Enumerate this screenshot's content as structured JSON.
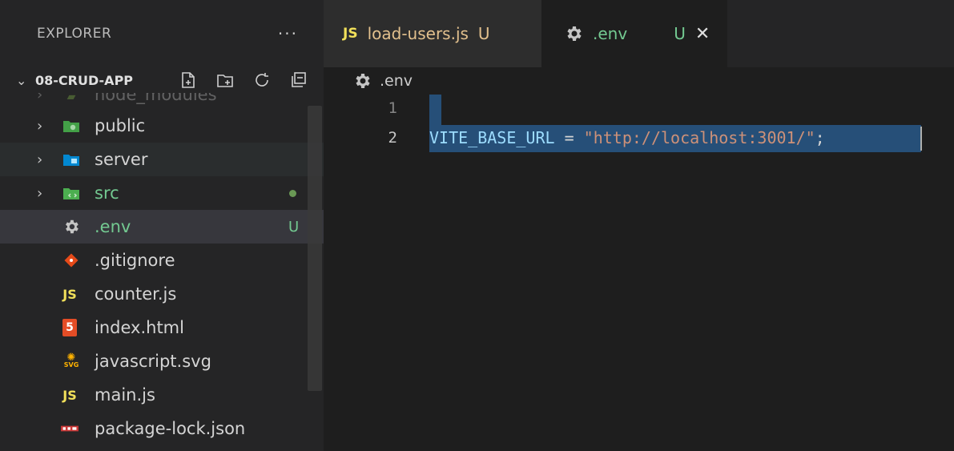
{
  "explorer": {
    "title": "EXPLORER",
    "more": "···",
    "folder_name": "08-CRUD-APP",
    "items": [
      {
        "name": "node_modules",
        "kind": "folder",
        "icon": "node-folder-icon"
      },
      {
        "name": "public",
        "kind": "folder",
        "icon": "public-folder-icon"
      },
      {
        "name": "server",
        "kind": "folder",
        "icon": "server-folder-icon"
      },
      {
        "name": "src",
        "kind": "folder",
        "icon": "src-folder-icon"
      },
      {
        "name": ".env",
        "kind": "file",
        "icon": "gear-icon",
        "badge": "U"
      },
      {
        "name": ".gitignore",
        "kind": "file",
        "icon": "git-icon"
      },
      {
        "name": "counter.js",
        "kind": "file",
        "icon": "js-icon",
        "icon_text": "JS"
      },
      {
        "name": "index.html",
        "kind": "file",
        "icon": "html5-icon",
        "icon_text": "5"
      },
      {
        "name": "javascript.svg",
        "kind": "file",
        "icon": "svg-icon",
        "icon_text": "SVG"
      },
      {
        "name": "main.js",
        "kind": "file",
        "icon": "js-icon",
        "icon_text": "JS"
      },
      {
        "name": "package-lock.json",
        "kind": "file",
        "icon": "npm-icon"
      }
    ]
  },
  "tabs": [
    {
      "label": "load-users.js",
      "badge_text": "JS",
      "status": "U",
      "icon": "js-icon"
    },
    {
      "label": ".env",
      "status": "U",
      "icon": "gear-icon",
      "close": "✕"
    }
  ],
  "breadcrumb": {
    "file": ".env",
    "icon": "gear-icon"
  },
  "editor": {
    "line_numbers": [
      "1",
      "2"
    ],
    "line2": {
      "key": "VITE_BASE_URL",
      "eq": " = ",
      "value": "\"http://localhost:3001/\"",
      "semi": ";"
    }
  },
  "colors": {
    "sidebar_bg": "#252526",
    "editor_bg": "#1e1e1e",
    "selection": "#264f78",
    "untracked_green": "#73c991",
    "js_yellow": "#f1e05a",
    "string_orange": "#ce9178",
    "key_blue": "#9cdcfe"
  }
}
